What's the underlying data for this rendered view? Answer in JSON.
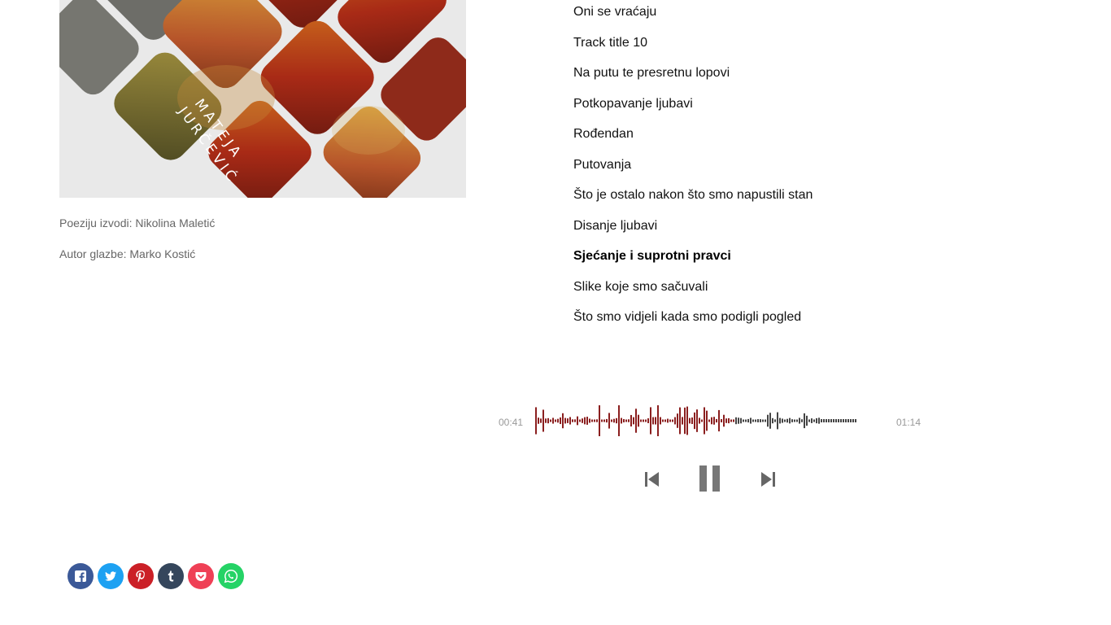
{
  "cover": {
    "artist_first": "MATEJA",
    "artist_last": "JURČEVIĆ"
  },
  "credits": {
    "poetry": "Poeziju izvodi: Nikolina Maletić",
    "music": "Autor glazbe: Marko Kostić"
  },
  "tracks": [
    {
      "title": "Oni se vraćaju"
    },
    {
      "title": "Track title 10"
    },
    {
      "title": "Na putu te presretnu lopovi"
    },
    {
      "title": "Potkopavanje ljubavi"
    },
    {
      "title": "Rođendan"
    },
    {
      "title": "Putovanja"
    },
    {
      "title": "Što je ostalo nakon što smo napustili stan"
    },
    {
      "title": "Disanje ljubavi"
    },
    {
      "title": "Sjećanje i suprotni pravci",
      "active": true
    },
    {
      "title": "Slike koje smo sačuvali"
    },
    {
      "title": "Što smo vidjeli kada smo podigli pogled"
    }
  ],
  "player": {
    "current_time": "00:41",
    "duration": "01:14",
    "played_fraction": 0.62,
    "played_color": "#8b1f1f",
    "unplayed_color": "#444444",
    "state": "playing",
    "controls": [
      "previous-icon",
      "pause-icon",
      "next-icon"
    ]
  },
  "share": [
    {
      "name": "facebook",
      "icon": "facebook-icon",
      "color": "#3b5998"
    },
    {
      "name": "twitter",
      "icon": "twitter-icon",
      "color": "#1da1f2"
    },
    {
      "name": "pinterest",
      "icon": "pinterest-icon",
      "color": "#cb2027"
    },
    {
      "name": "tumblr",
      "icon": "tumblr-icon",
      "color": "#35465c"
    },
    {
      "name": "pocket",
      "icon": "pocket-icon",
      "color": "#ef4056"
    },
    {
      "name": "whatsapp",
      "icon": "whatsapp-icon",
      "color": "#25d366"
    }
  ]
}
